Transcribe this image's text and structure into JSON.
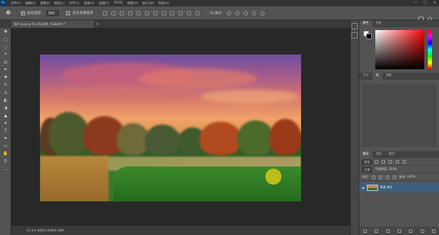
{
  "menu": {
    "logo": "Ps",
    "items": [
      "文件(F)",
      "编辑(E)",
      "图像(I)",
      "图层(L)",
      "文字(Y)",
      "选择(S)",
      "滤镜(T)",
      "3D(D)",
      "视图(V)",
      "窗口(W)",
      "帮助(H)"
    ],
    "win_min": "—",
    "win_max": "□",
    "win_close": "✕"
  },
  "options": {
    "move_glyph": "✥",
    "auto_select_check": "✓",
    "auto_select_label": "自动选择:",
    "auto_select_value": "图层",
    "transform_label": "显示变换控件",
    "mode_3d": "3D 模式:"
  },
  "document": {
    "tab_label": "图片.jpeg @ 41.4%(背景, RGB/8#) *",
    "close_glyph": "×"
  },
  "status": {
    "zoom_text": "41.4%    文档:4.94M/4.94M"
  },
  "tools": [
    "✥",
    "⬚",
    "◌",
    "⌖",
    "⊡",
    "✒",
    "✚",
    "✎",
    "⌂",
    "◐",
    "◑",
    "▲",
    "✦",
    "T",
    "➤",
    "▭",
    "✋",
    "⚲",
    "…"
  ],
  "color_panel": {
    "tabs": [
      "颜色",
      "色板"
    ]
  },
  "swatches_panel": {
    "tabs": [
      "学习",
      "库",
      "调整"
    ]
  },
  "layers_panel": {
    "tabs": [
      "图层",
      "通道",
      "路径"
    ],
    "filter_label": "类型",
    "blend_mode": "正常",
    "opacity_label": "不透明度: 100%",
    "lock_label": "锁定:",
    "fill_label": "填充: 100%",
    "layer_name": "背景 拷贝"
  },
  "colors": {
    "accent": "#31a8ff",
    "workspace_bg": "#282828",
    "panel_bg": "#535353",
    "highlight_dot": "#c9c21a"
  }
}
